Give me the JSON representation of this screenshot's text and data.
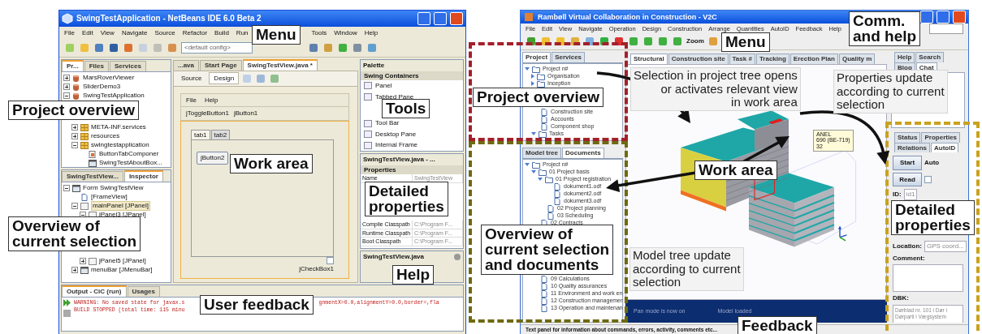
{
  "left_window": {
    "title": "SwingTestApplication - NetBeans IDE 6.0 Beta 2",
    "menu_groups": [
      [
        "File",
        "Edit",
        "View",
        "Navigate",
        "Source",
        "Refactor",
        "Build",
        "Run"
      ],
      [
        "Tools",
        "Window",
        "Help"
      ]
    ],
    "config_combo": "<default config>",
    "projects_panel": {
      "tabs": [
        {
          "label": "Pr...",
          "selected": true
        },
        {
          "label": "Files",
          "selected": false
        },
        {
          "label": "Services",
          "selected": false
        }
      ],
      "tree": [
        {
          "label": "MarsRoverViewer",
          "kind": "project",
          "expanded": false
        },
        {
          "label": "SliderDemo3",
          "kind": "project",
          "expanded": false
        },
        {
          "label": "SwingTestApplication",
          "kind": "project",
          "expanded": true,
          "children": [
            {
              "label": "META-INF.services",
              "kind": "package",
              "expanded": false
            },
            {
              "label": "resources",
              "kind": "package",
              "expanded": false
            },
            {
              "label": "swingtestapplication",
              "kind": "package",
              "expanded": true,
              "children": [
                {
                  "label": "ButtonTabComponer",
                  "kind": "class"
                },
                {
                  "label": "SwingTestAboutBox...",
                  "kind": "form"
                }
              ]
            }
          ]
        }
      ]
    },
    "inspector_panel": {
      "tabs": [
        {
          "label": "SwingTestView...",
          "selected": false
        },
        {
          "label": "Inspector",
          "selected": true
        }
      ],
      "tree": [
        {
          "label": "Form SwingTestView",
          "kind": "form",
          "expanded": true,
          "selected": false,
          "children": [
            {
              "label": "[FrameView]",
              "kind": "document",
              "selected": false
            },
            {
              "label": "mainPanel [JPanel]",
              "kind": "panel",
              "expanded": true,
              "selected": true,
              "children": [
                {
                  "label": "jPanel3 [JPanel]",
                  "kind": "panel",
                  "expanded": true,
                  "selected": false
                },
                {
                  "label": "jPanel5 [JPanel]",
                  "kind": "panel",
                  "expanded": false,
                  "selected": false
                }
              ]
            },
            {
              "label": "menuBar [JMenuBar]",
              "kind": "form",
              "expanded": false,
              "selected": false
            }
          ]
        }
      ]
    },
    "editor": {
      "tabs": [
        {
          "label": "...ava",
          "selected": false
        },
        {
          "label": "Start Page",
          "selected": false
        },
        {
          "label": "SwingTestView.java *",
          "selected": true
        }
      ],
      "views": [
        {
          "label": "Source",
          "selected": false
        },
        {
          "label": "Design",
          "selected": true
        }
      ],
      "form": {
        "menu": [
          "File",
          "Help"
        ],
        "toolbar_buttons": [
          "jToggleButton1",
          "jButton1"
        ],
        "tabs": [
          {
            "label": "tab1",
            "selected": true
          },
          {
            "label": "tab2",
            "selected": false
          }
        ],
        "button": "jButton2",
        "checkbox": {
          "label": "jCheckBox1",
          "checked": false
        }
      }
    },
    "palette": {
      "title": "Palette",
      "category": "Swing Containers",
      "items": [
        "Panel",
        "Tabbed Pane",
        "Tool Bar",
        "Desktop Pane",
        "Internal Frame"
      ]
    },
    "properties": {
      "title": "SwingTestView.java - ...",
      "section": "Properties",
      "rows": [
        {
          "name": "Name",
          "value": "SwingTestView"
        },
        {
          "name": "Compile Classpath",
          "value": "C:\\Program F..."
        },
        {
          "name": "Runtime Classpath",
          "value": "C:\\Program F..."
        },
        {
          "name": "Boot Classpath",
          "value": "C:\\Program F..."
        }
      ]
    },
    "help": {
      "title": "SwingTestView.java"
    },
    "output": {
      "tabs": [
        {
          "label": "Output - CiC (run)",
          "selected": true
        },
        {
          "label": "Usages",
          "selected": false
        }
      ],
      "lines": [
        {
          "text": "WARNING: No saved state for javax.s",
          "tail": "gnmentX=0.0,alignmentY=0.0,border=,fla"
        },
        {
          "text": "BUILD STOPPED (total time: 115 minu"
        }
      ]
    }
  },
  "left_annotations": [
    {
      "text": "Menu",
      "kind": "callout"
    },
    {
      "text": "Project overview",
      "kind": "callout"
    },
    {
      "text": "Tools",
      "kind": "callout"
    },
    {
      "text": "Work area",
      "kind": "callout"
    },
    {
      "text": "Detailed\nproperties",
      "kind": "callout"
    },
    {
      "text": "Overview of\ncurrent selection",
      "kind": "callout"
    },
    {
      "text": "Help",
      "kind": "callout"
    },
    {
      "text": "User feedback",
      "kind": "callout"
    }
  ],
  "right_window": {
    "title": "Rambøll Virtual Collaboration in Construction - V2C",
    "menu": [
      "File",
      "Edit",
      "View",
      "Navigate",
      "Operation",
      "Design",
      "Construction",
      "Arrange",
      "Quantities",
      "AutoID",
      "Feedback",
      "Help"
    ],
    "zoom_label": "Zoom",
    "project_panel": {
      "tabs": [
        {
          "label": "Project",
          "selected": true
        },
        {
          "label": "Services",
          "selected": false
        }
      ],
      "tree": [
        {
          "label": "Project n#",
          "kind": "folder",
          "expanded": true,
          "children": [
            {
              "label": "Organisation",
              "kind": "folder",
              "expanded": false
            },
            {
              "label": "Inception",
              "kind": "folder",
              "expanded": false
            },
            {
              "label": "Construction site",
              "kind": "document"
            },
            {
              "label": "Accounts",
              "kind": "document"
            },
            {
              "label": "Component shop",
              "kind": "document"
            },
            {
              "label": "Tasks",
              "kind": "folder",
              "expanded": true
            }
          ]
        }
      ]
    },
    "model_panel": {
      "tabs": [
        {
          "label": "Model tree",
          "selected": false
        },
        {
          "label": "Documents",
          "selected": true
        }
      ],
      "tree": [
        {
          "label": "Project n#",
          "kind": "folder",
          "expanded": true,
          "children": [
            {
              "label": "01 Project basis",
              "kind": "folder",
              "expanded": true,
              "children": [
                {
                  "label": "01 Project registration",
                  "kind": "folder",
                  "expanded": true,
                  "children": [
                    {
                      "label": "dokument1.odf",
                      "kind": "document"
                    },
                    {
                      "label": "dokument2.odf",
                      "kind": "document"
                    },
                    {
                      "label": "dokument3.odf",
                      "kind": "document"
                    }
                  ]
                },
                {
                  "label": "02 Project planning",
                  "kind": "document"
                },
                {
                  "label": "03 Scheduling",
                  "kind": "document"
                }
              ]
            },
            {
              "label": "02 Contracts",
              "kind": "document"
            },
            {
              "label": "09 Calculations",
              "kind": "document"
            },
            {
              "label": "10 Quality assurances",
              "kind": "document"
            },
            {
              "label": "11 Environment and work en",
              "kind": "document"
            },
            {
              "label": "12 Construction managemen",
              "kind": "document"
            },
            {
              "label": "13 Operation and maintenan",
              "kind": "document"
            }
          ]
        }
      ]
    },
    "work_tabs": [
      {
        "label": "Structural",
        "selected": true
      },
      {
        "label": "Construction site",
        "selected": false
      },
      {
        "label": "Task #",
        "selected": false
      },
      {
        "label": "Tracking",
        "selected": false
      },
      {
        "label": "Erection Plan",
        "selected": false
      },
      {
        "label": "Quality m",
        "selected": false
      }
    ],
    "tooltip": [
      "ANEL",
      "690 (BE-719)",
      "32"
    ],
    "feedback_lines": [
      "Pan mode is now on",
      "Model loaded"
    ],
    "comm_panel": {
      "tabs_row1": [
        {
          "label": "Help",
          "selected": false
        },
        {
          "label": "Search",
          "selected": false
        }
      ],
      "tabs_row2": [
        {
          "label": "Blog",
          "selected": false
        },
        {
          "label": "Chat",
          "selected": true
        }
      ]
    },
    "props_panel": {
      "tabs_row1": [
        {
          "label": "Status",
          "selected": false
        },
        {
          "label": "Properties",
          "selected": false
        }
      ],
      "tabs_row2": [
        {
          "label": "Relations",
          "selected": false
        },
        {
          "label": "AutoID",
          "selected": true
        }
      ],
      "start_button": "Start",
      "auto_label": "Auto",
      "read_button": "Read",
      "auto_checkbox": {
        "checked": false
      },
      "fields": [
        {
          "label": "ID:",
          "value": "id1",
          "kind": "line"
        },
        {
          "label": "Location:",
          "value": "GPS coord...",
          "kind": "line"
        },
        {
          "label": "Comment:",
          "kind": "area"
        },
        {
          "label": "DBK:",
          "value": "Dørblad nr. 101 i Dør i Dørparti i Vægsystem",
          "kind": "area"
        }
      ]
    },
    "status_text": "Text panel for information about commands, errors, activity, comments etc..."
  },
  "right_annotations": [
    {
      "text": "Menu",
      "kind": "callout"
    },
    {
      "text": "Comm.\nand help",
      "kind": "callout"
    },
    {
      "text": "Project overview",
      "kind": "callout"
    },
    {
      "text": "Selection in project tree opens\nor activates relevant view\nin work area",
      "kind": "note"
    },
    {
      "text": "Properties update\naccording to current\nselection",
      "kind": "note"
    },
    {
      "text": "Work area",
      "kind": "callout"
    },
    {
      "text": "Detailed\nproperties",
      "kind": "callout"
    },
    {
      "text": "Overview of\ncurrent selection\nand documents",
      "kind": "callout"
    },
    {
      "text": "Model tree update\naccording to current\nselection",
      "kind": "note"
    },
    {
      "text": "Feedback",
      "kind": "callout"
    }
  ]
}
